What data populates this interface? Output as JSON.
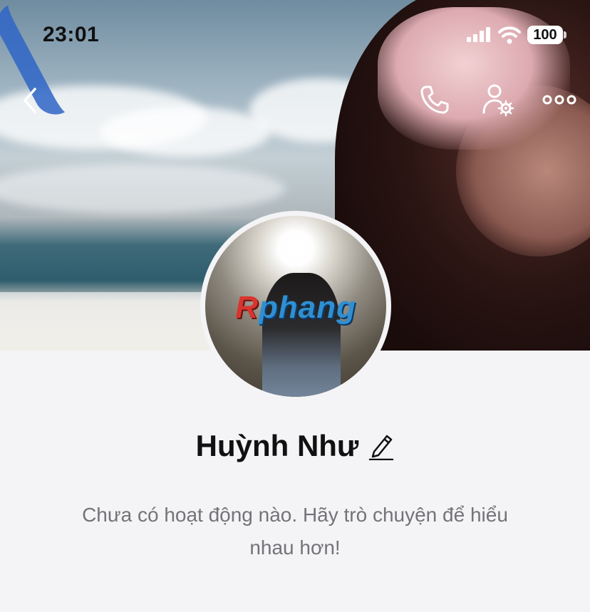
{
  "status_bar": {
    "time": "23:01",
    "battery": "100"
  },
  "header": {
    "back_icon": "chevron-left-icon",
    "call_icon": "phone-icon",
    "settings_icon": "user-gear-icon",
    "more_icon": "ellipsis-icon"
  },
  "profile": {
    "name": "Huỳnh Như",
    "edit_icon": "pencil-icon",
    "avatar_watermark_r": "R",
    "avatar_watermark_rest": "phang"
  },
  "activity": {
    "empty_message": "Chưa có hoạt động nào. Hãy trò chuyện để hiểu nhau hơn!"
  },
  "colors": {
    "background": "#f4f4f6",
    "text_primary": "#111111",
    "text_secondary": "#737378",
    "icon_white": "#ffffff"
  }
}
